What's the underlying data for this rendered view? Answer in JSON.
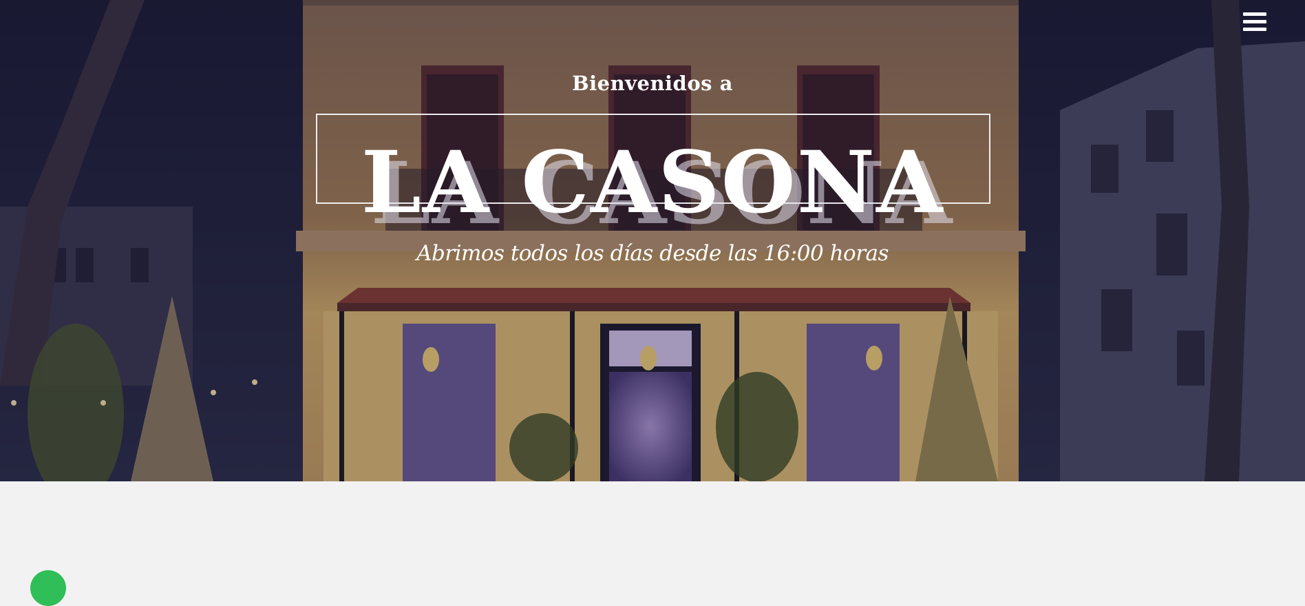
{
  "header": {
    "menu_icon": "hamburger-menu-icon"
  },
  "hero": {
    "welcome": "Bienvenidos a",
    "title": "LA CASONA",
    "subtitle": "Abrimos todos los días desde las 16:00 horas"
  },
  "colors": {
    "text": "#ffffff",
    "page_background": "#f2f2f2",
    "night_sky": "#1b1a33",
    "facade": "#e0b36a",
    "badge": "#2fbe57"
  },
  "widgets": {
    "chat_icon": "whatsapp-icon"
  }
}
